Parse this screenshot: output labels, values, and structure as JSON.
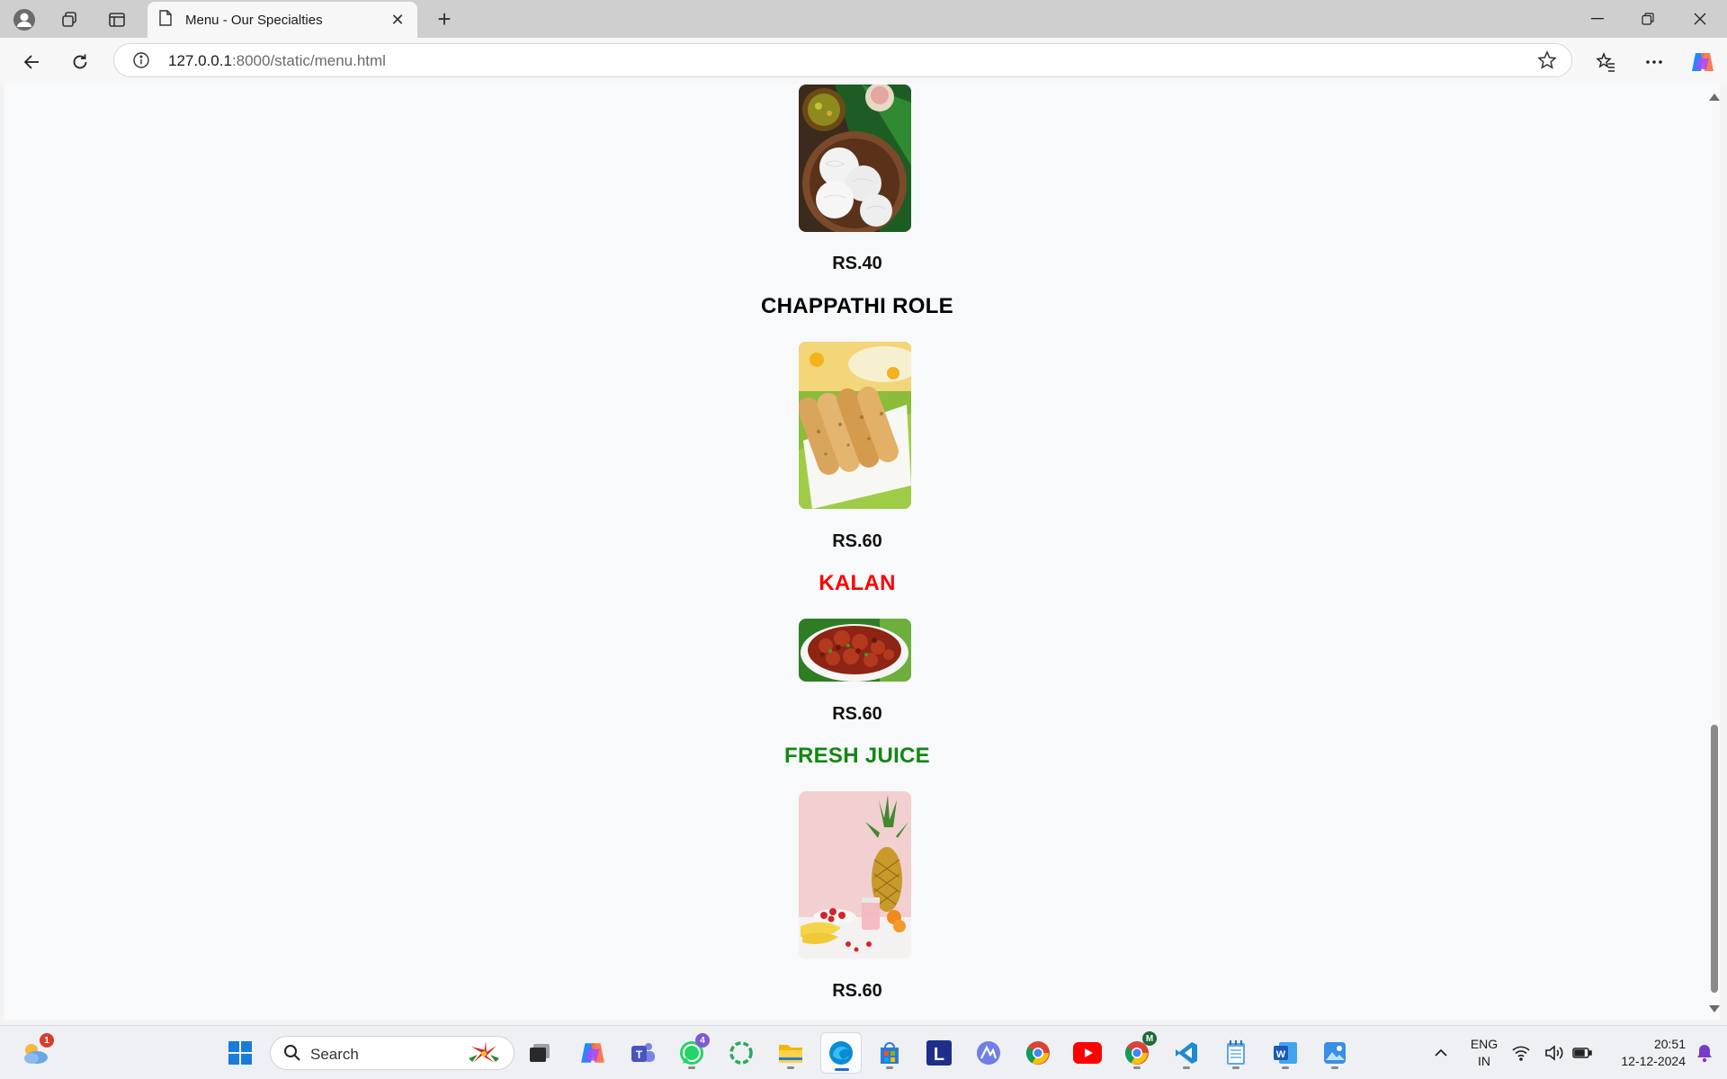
{
  "browser": {
    "tab_title": "Menu - Our Specialties",
    "url_host": "127.0.0.1",
    "url_path": ":8000/static/menu.html"
  },
  "menu": {
    "items": [
      {
        "price": "RS.40"
      },
      {
        "name": "CHAPPATHI ROLE",
        "name_color": "#000000",
        "price": "RS.60"
      },
      {
        "name": "KALAN",
        "name_color": "#ff0000",
        "price": "RS.60"
      },
      {
        "name": "FRESH JUICE",
        "name_color": "#118811",
        "price": "RS.60"
      }
    ]
  },
  "taskbar": {
    "search_placeholder": "Search",
    "weather_badge": "1",
    "whatsapp_badge": "4",
    "chrome_profile_letter": "M",
    "language_line1": "ENG",
    "language_line2": "IN",
    "time": "20:51",
    "date": "12-12-2024"
  }
}
